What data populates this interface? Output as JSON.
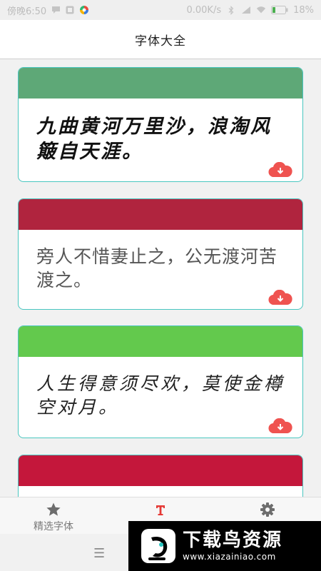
{
  "status_bar": {
    "time": "傍晚6:50",
    "speed": "0.00K/s",
    "battery": "18%",
    "icons": [
      "message-icon",
      "app-icon",
      "browser-icon",
      "bluetooth-icon",
      "signal-icon",
      "wifi-icon",
      "battery-icon"
    ]
  },
  "header": {
    "title": "字体大全"
  },
  "cards": [
    {
      "sample_text": "九曲黄河万里沙，浪淘风簸自天涯。",
      "band_color": "#5ea877"
    },
    {
      "sample_text": "旁人不惜妻止之，公无渡河苦渡之。",
      "band_color": "#b0243e"
    },
    {
      "sample_text": "人生得意须尽欢，莫使金樽空对月。",
      "band_color": "#63c94d"
    },
    {
      "sample_text": "",
      "band_color": "#c4173b"
    }
  ],
  "bottom_nav": {
    "items": [
      {
        "label": "精选字体",
        "icon": "star-icon"
      },
      {
        "label": "",
        "icon": "font-icon"
      },
      {
        "label": "",
        "icon": "gear-icon"
      }
    ]
  },
  "watermark": {
    "title": "下载鸟资源",
    "url": "www.xiazainiao.com"
  },
  "colors": {
    "accent": "#e53935",
    "card_border": "#49c6c0",
    "download_icon": "#ef5350"
  }
}
